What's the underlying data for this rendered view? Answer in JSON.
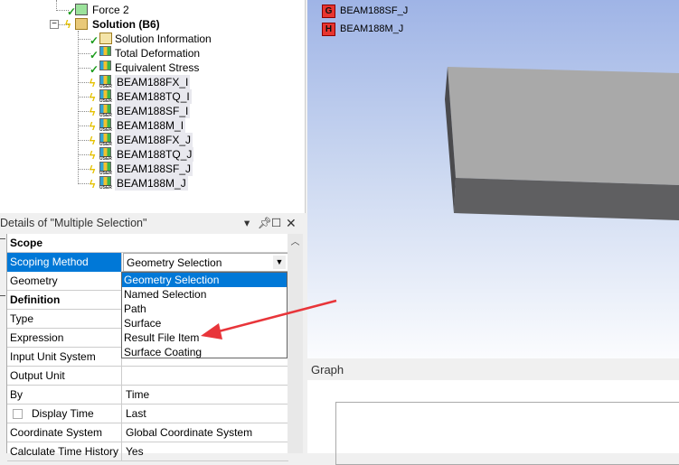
{
  "tree": {
    "force2": "Force 2",
    "solution": "Solution (B6)",
    "children": [
      {
        "label": "Solution Information",
        "status": "check",
        "icon": "info-folder-icon"
      },
      {
        "label": "Total Deformation",
        "status": "check",
        "icon": "result-cube-icon"
      },
      {
        "label": "Equivalent Stress",
        "status": "check",
        "icon": "result-cube-icon"
      },
      {
        "label": "BEAM188FX_I",
        "status": "bolt",
        "icon": "user-result-icon"
      },
      {
        "label": "BEAM188TQ_I",
        "status": "bolt",
        "icon": "user-result-icon"
      },
      {
        "label": "BEAM188SF_I",
        "status": "bolt",
        "icon": "user-result-icon"
      },
      {
        "label": "BEAM188M_I",
        "status": "bolt",
        "icon": "user-result-icon"
      },
      {
        "label": "BEAM188FX_J",
        "status": "bolt",
        "icon": "user-result-icon"
      },
      {
        "label": "BEAM188TQ_J",
        "status": "bolt",
        "icon": "user-result-icon"
      },
      {
        "label": "BEAM188SF_J",
        "status": "bolt",
        "icon": "user-result-icon"
      },
      {
        "label": "BEAM188M_J",
        "status": "bolt",
        "icon": "user-result-icon"
      }
    ],
    "user_tag": "USER",
    "collapse": "−"
  },
  "details": {
    "title": "Details of \"Multiple Selection\"",
    "rows": [
      {
        "section": true,
        "label": "Scope"
      },
      {
        "label": "Scoping Method",
        "value": "Geometry Selection",
        "selected": true
      },
      {
        "label": "Geometry",
        "value": ""
      },
      {
        "section": true,
        "label": "Definition"
      },
      {
        "label": "Type",
        "value": ""
      },
      {
        "label": "Expression",
        "value": ""
      },
      {
        "label": "Input Unit System",
        "value": ""
      },
      {
        "label": "Output Unit",
        "value": ""
      },
      {
        "label": "By",
        "value": "Time"
      },
      {
        "label": "Display Time",
        "value": "Last",
        "checkbox": true
      },
      {
        "label": "Coordinate System",
        "value": "Global Coordinate System"
      },
      {
        "label": "Calculate Time History",
        "value": "Yes"
      }
    ],
    "dropdown_options": [
      "Geometry Selection",
      "Named Selection",
      "Path",
      "Surface",
      "Result File Item",
      "Surface Coating"
    ],
    "dropdown_selected": "Geometry Selection"
  },
  "viewport": {
    "legend": [
      {
        "letter": "G",
        "label": "BEAM188SF_J"
      },
      {
        "letter": "H",
        "label": "BEAM188M_J"
      }
    ]
  },
  "graph": {
    "title": "Graph"
  },
  "colors": {
    "selection": "#0078d7",
    "annotation_arrow": "#e8353a",
    "legend_box": "#e8352f"
  }
}
